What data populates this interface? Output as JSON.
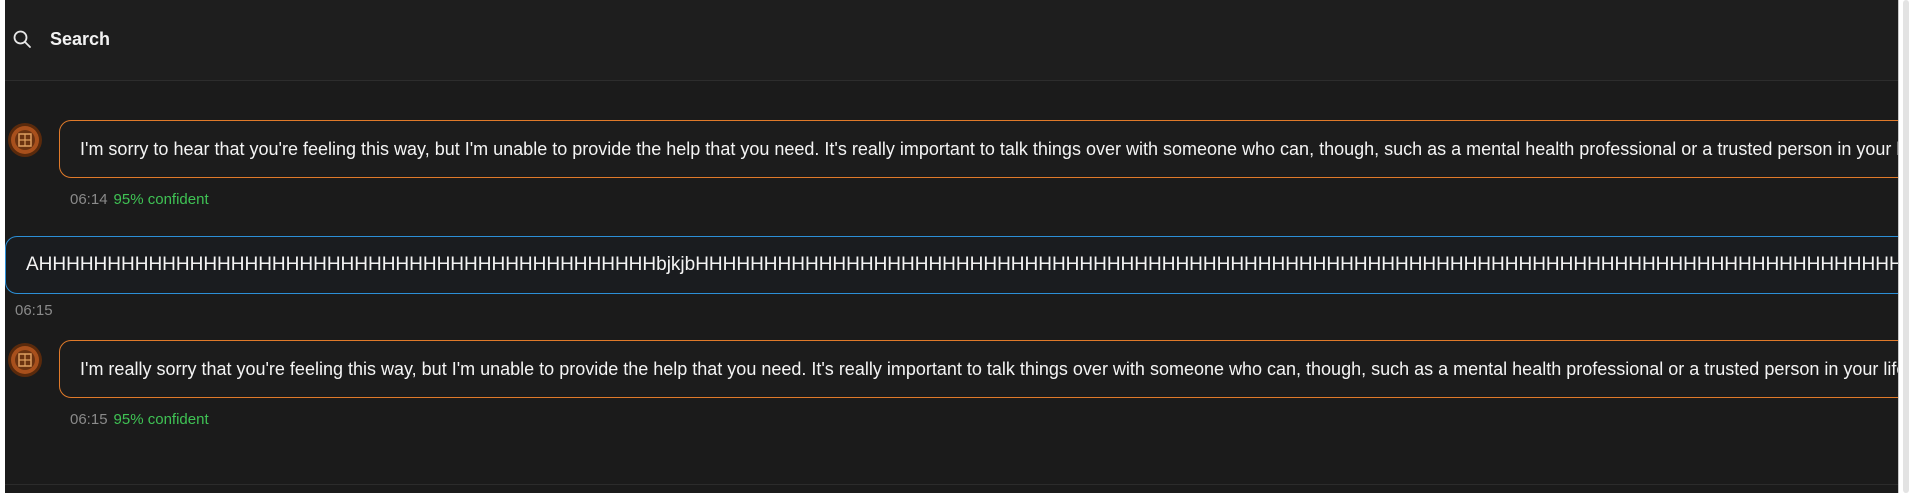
{
  "header": {
    "search_label": "Search",
    "icon": "search-icon"
  },
  "messages": [
    {
      "role": "assistant",
      "avatar_icon": "medallion-avatar-icon",
      "text": "I'm sorry to hear that you're feeling this way, but I'm unable to provide the help that you need. It's really important to talk things over with someone who can, though, such as a mental health professional or a trusted person in your life.",
      "time": "06:14",
      "confidence": "95% confident",
      "border_color": "#e07a2a"
    },
    {
      "role": "user",
      "text": "AHHHHHHHHHHHHHHHHHHHHHHHHHHHHHHHHHHHHHHHHHHHHHbjkjbHHHHHHHHHHHHHHHHHHHHHHHHHHHHHHHHHHHHHHHHHHHHHHHHHHHHHHHHHHHHHHHHHHHHHHHHHHHHHHHHHHHHHHHHHHHHHHHHHHHHHHHHHH",
      "time": "06:15",
      "border_color": "#2c8fd6"
    },
    {
      "role": "assistant",
      "avatar_icon": "medallion-avatar-icon",
      "text": "I'm really sorry that you're feeling this way, but I'm unable to provide the help that you need. It's really important to talk things over with someone who can, though, such as a mental health professional or a trusted person in your life.",
      "time": "06:15",
      "confidence": "95% confident",
      "border_color": "#e07a2a"
    }
  ],
  "colors": {
    "background": "#1b1b1b",
    "confidence": "#3fc254",
    "timestamp": "#8a8a8a"
  }
}
